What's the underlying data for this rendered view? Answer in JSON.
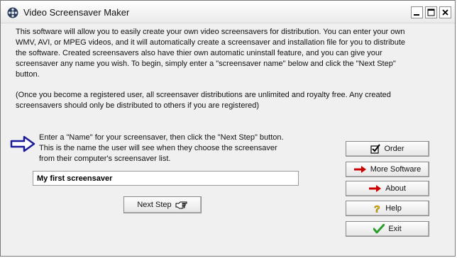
{
  "window": {
    "title": "Video Screensaver Maker",
    "icon": "film-reel-icon"
  },
  "titlebar_buttons": {
    "minimize": "minimize-icon",
    "maximize": "maximize-icon",
    "close": "close-icon"
  },
  "description": {
    "paragraph1": "This software will allow you to easily create your own video screensavers for distribution.  You can enter your own WMV, AVI, or MPEG videos, and it will automatically create a screensaver and installation file for you to distribute the software.  Created screensavers also have thier own automatic uninstall feature, and you can give your screensaver any name you wish.  To begin, simply enter a \"screensaver name\" below and click the \"Next Step\" button.",
    "paragraph2": "(Once you become a registered user, all screensaver distributions are unlimited and royalty free. Any created screensavers should only be distributed to others if you are registered)"
  },
  "instruction": {
    "text": "Enter a \"Name\" for your screensaver, then click the \"Next Step\" button.  This is the name the user will see when they choose the screensaver from their computer's screensaver list.",
    "icon": "right-arrow-icon"
  },
  "name_input": {
    "value": "My first screensaver"
  },
  "next_button": {
    "label": "Next Step",
    "icon": "pointing-hand-icon"
  },
  "side_buttons": {
    "order": {
      "label": "Order",
      "icon": "checkbox-icon"
    },
    "more_software": {
      "label": "More Software",
      "icon": "red-arrow-icon"
    },
    "about": {
      "label": "About",
      "icon": "red-arrow-icon"
    },
    "help": {
      "label": "Help",
      "icon": "question-mark-icon"
    },
    "exit": {
      "label": "Exit",
      "icon": "green-check-icon"
    }
  },
  "colors": {
    "window_bg": "#f0f0f0",
    "arrow_blue": "#1a1a9a",
    "red_arrow": "#cc0000",
    "help_yellow": "#f3c400",
    "exit_green": "#2a9d2a"
  }
}
